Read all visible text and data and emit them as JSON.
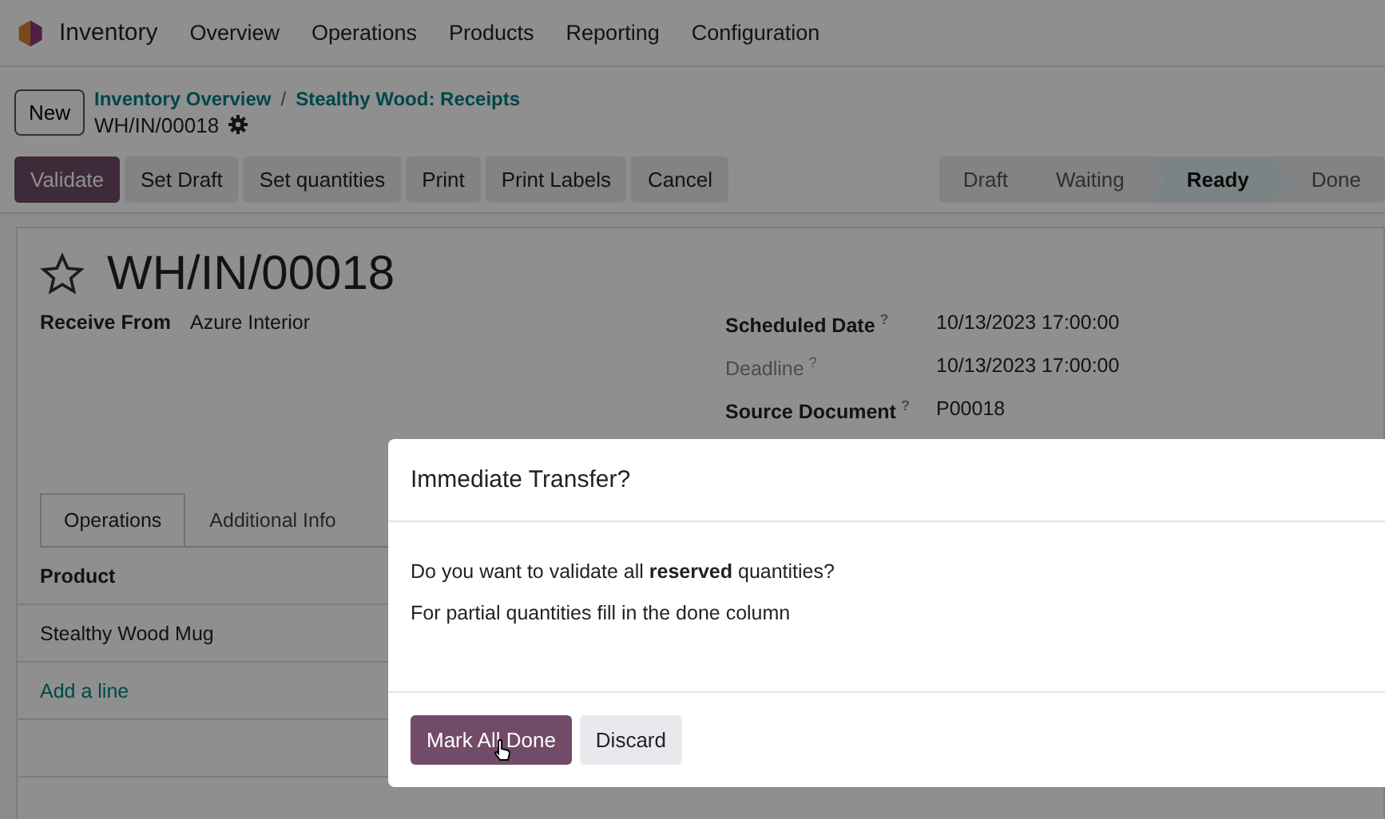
{
  "navbar": {
    "app": "Inventory",
    "menu": [
      "Overview",
      "Operations",
      "Products",
      "Reporting",
      "Configuration"
    ]
  },
  "control_panel": {
    "new_button": "New",
    "breadcrumb": [
      "Inventory Overview",
      "Stealthy Wood: Receipts"
    ],
    "separator": "/",
    "record": "WH/IN/00018"
  },
  "actions": [
    {
      "label": "Validate",
      "primary": true
    },
    {
      "label": "Set Draft",
      "primary": false
    },
    {
      "label": "Set quantities",
      "primary": false
    },
    {
      "label": "Print",
      "primary": false
    },
    {
      "label": "Print Labels",
      "primary": false
    },
    {
      "label": "Cancel",
      "primary": false
    }
  ],
  "stages": [
    {
      "label": "Draft",
      "selected": false
    },
    {
      "label": "Waiting",
      "selected": false
    },
    {
      "label": "Ready",
      "selected": true
    },
    {
      "label": "Done",
      "selected": false
    }
  ],
  "form": {
    "title": "WH/IN/00018",
    "favorite": false,
    "left_fields": [
      {
        "label": "Receive From",
        "value": "Azure Interior"
      }
    ],
    "right_fields": [
      {
        "label": "Scheduled Date",
        "help": "?",
        "value": "10/13/2023 17:00:00",
        "muted": false
      },
      {
        "label": "Deadline",
        "help": "?",
        "value": "10/13/2023 17:00:00",
        "muted": true
      },
      {
        "label": "Source Document",
        "help": "?",
        "value": "P00018",
        "muted": false
      }
    ],
    "tabs": [
      {
        "label": "Operations",
        "selected": true
      },
      {
        "label": "Additional Info",
        "selected": false
      }
    ],
    "table": {
      "columns": [
        "Product"
      ],
      "rows": [
        "Stealthy Wood Mug"
      ],
      "add_line": "Add a line"
    }
  },
  "dialog": {
    "title": "Immediate Transfer?",
    "question": "Do you want to validate all **reserved** quantities?",
    "hint": "For partial quantities fill in the done column",
    "buttons": [
      {
        "label": "Mark All Done",
        "primary": true
      },
      {
        "label": "Discard",
        "primary": false
      }
    ]
  }
}
